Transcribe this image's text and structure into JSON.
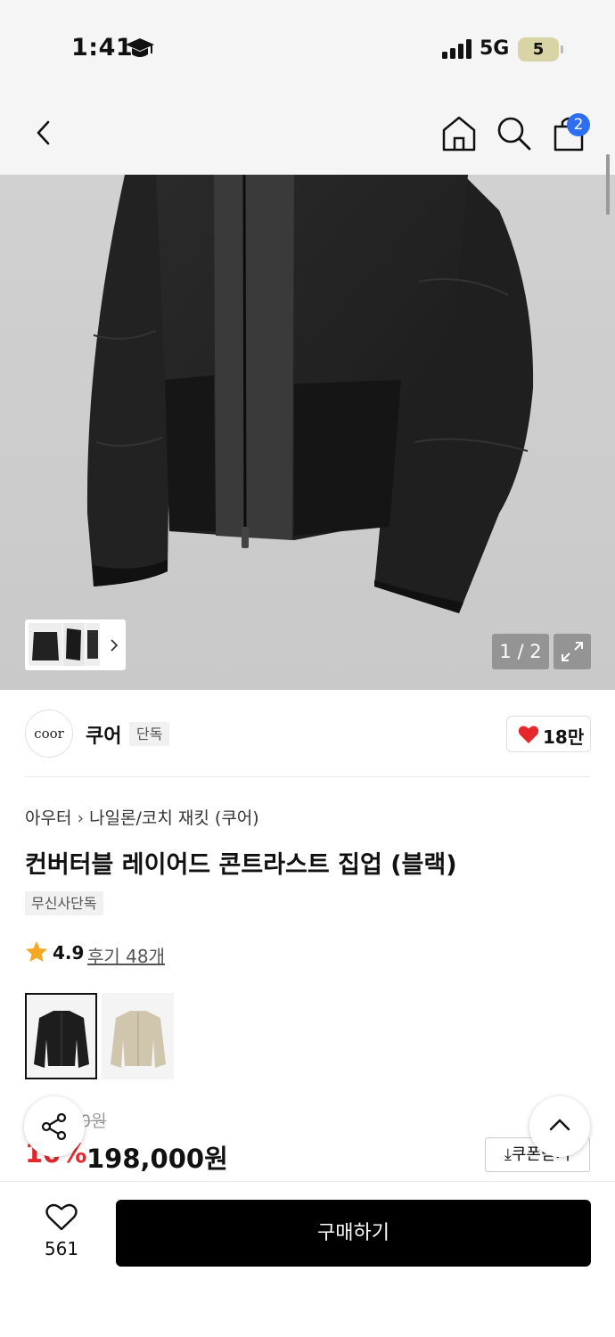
{
  "status_bar": {
    "time": "1:41",
    "network": "5G",
    "battery": "5"
  },
  "nav": {
    "back_icon": "chevron-left-icon",
    "home_icon": "home-icon",
    "search_icon": "search-icon",
    "cart_icon": "shopping-bag-icon",
    "cart_count": "2"
  },
  "gallery": {
    "counter": "1 / 2",
    "expand_icon": "expand-icon"
  },
  "brand": {
    "logo_text": "coor",
    "name": "쿠어",
    "badge": "단독",
    "like_count": "18만"
  },
  "product": {
    "breadcrumb": [
      "아우터",
      "나일론/코치 재킷 (쿠어)"
    ],
    "title": "컨버터블 레이어드 콘트라스트 집업 (블랙)",
    "tag": "무신사단독",
    "rating": "4.9",
    "reviews": "후기 48개",
    "original_price": "0원",
    "discount": "10%",
    "price": "198,000원",
    "coupon_label": "쿠폰받기"
  },
  "bottom": {
    "wish_count": "561",
    "buy_label": "구매하기"
  },
  "colors": {
    "accent_red": "#e6272c",
    "badge_blue": "#2e6ff2",
    "buy_black": "#000000"
  }
}
